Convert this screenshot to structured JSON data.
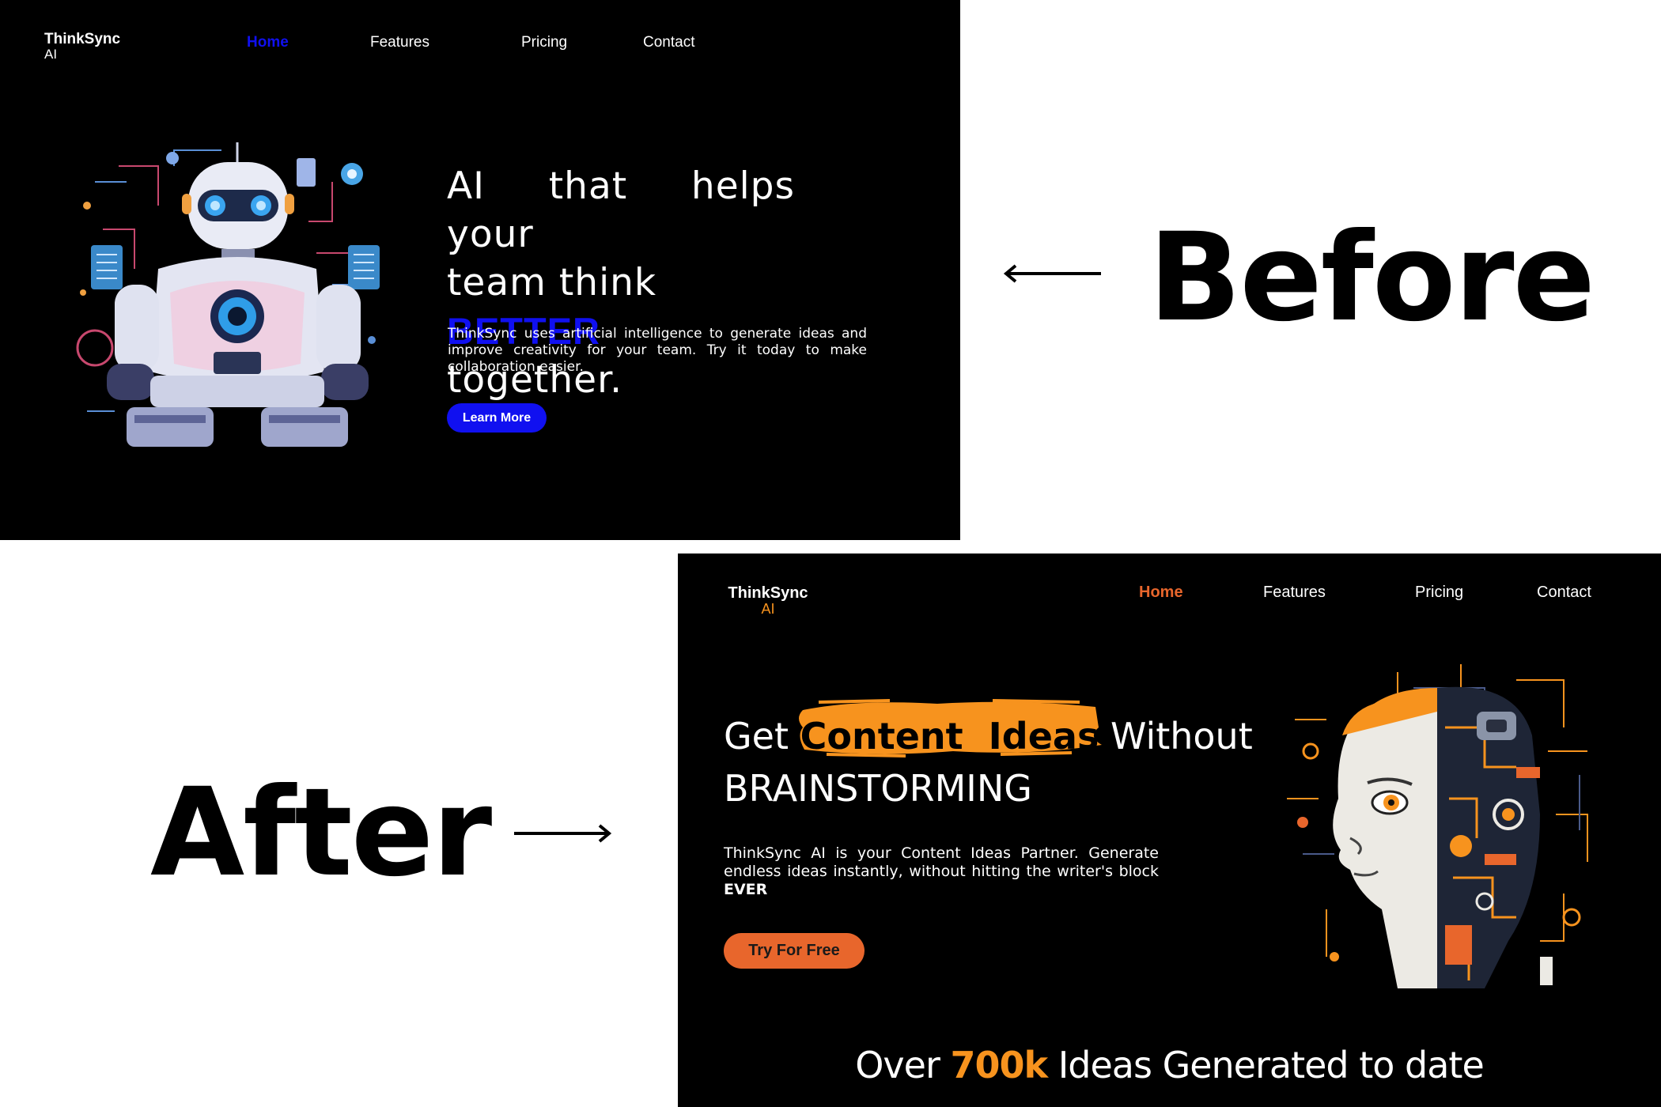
{
  "labels": {
    "before": "Before",
    "after": "After"
  },
  "before": {
    "logo": {
      "name": "ThinkSync",
      "sub": "AI"
    },
    "nav": [
      "Home",
      "Features",
      "Pricing",
      "Contact"
    ],
    "headline": {
      "line1": "AI that helps your",
      "line2_pre": "team think ",
      "highlight": "BETTER",
      "line3": "together."
    },
    "description": "ThinkSync uses artificial intelligence to generate ideas and improve creativity for your team. Try it today to make collaboration easier.",
    "cta": "Learn More",
    "accent": "#1010f0"
  },
  "after": {
    "logo": {
      "name": "ThinkSync",
      "sub": "AI"
    },
    "nav": [
      "Home",
      "Features",
      "Pricing",
      "Contact"
    ],
    "headline": {
      "pre": "Get",
      "highlight": "Content  Ideas",
      "post": "Without",
      "line2": "BRAINSTORMING"
    },
    "description": "ThinkSync AI is your Content Ideas Partner. Generate endless ideas instantly, without hitting the writer's block",
    "description_bold": "EVER",
    "cta": "Try For Free",
    "stats": {
      "pre": "Over ",
      "value": "700k",
      "post": " Ideas Generated to date"
    },
    "accent": "#f7931e",
    "button_color": "#e8662c"
  },
  "icons": [
    "robot-illustration-icon",
    "ai-face-illustration-icon",
    "arrow-left-icon",
    "arrow-right-icon"
  ]
}
